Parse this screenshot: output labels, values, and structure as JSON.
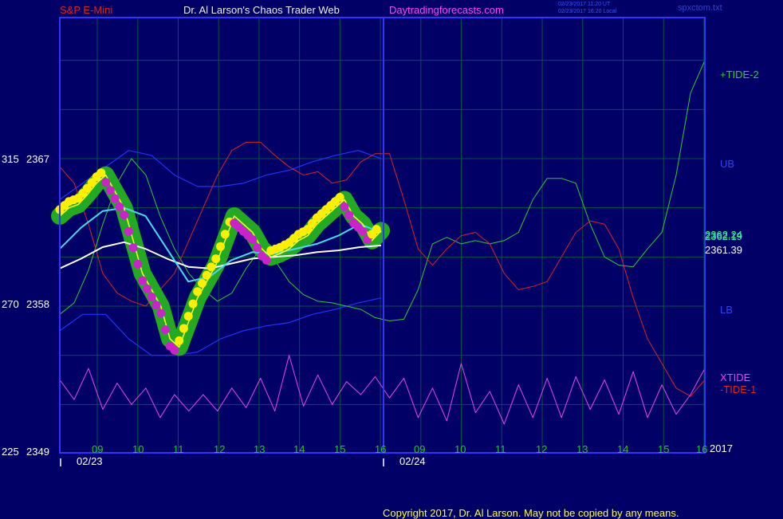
{
  "header": {
    "symbol": "S&P E-Mini",
    "author": "Dr. Al Larson's Chaos Trader Web",
    "site": "Daytradingforecasts.com",
    "timestamp1": "02/23/2017 11:20 UT",
    "timestamp2": "02/23/2017 16:20 Local",
    "file": "spxctom.txt"
  },
  "right_labels": {
    "tide2": "+TIDE-2",
    "ub": "UB",
    "price1": "2362.24",
    "price2": "2362.19",
    "price3": "2361.39",
    "lb": "LB",
    "xtide": "XTIDE",
    "tide1": "-TIDE-1",
    "year": "2017"
  },
  "footer": {
    "copyright": "Copyright 2017, Dr. Al Larson. May not be copied by any means."
  },
  "colors": {
    "background": "#000066",
    "frame": "#3333ff",
    "grid": "#005544",
    "tide2": "#33cc33",
    "tide1": "#dd2222",
    "xtide": "#ee44ee",
    "bands": "#2233ff",
    "cyan_avg": "#44ddee",
    "white_avg": "#ffffff",
    "price": "#ffff33",
    "hot_dots": "#ffee00",
    "cold_dots": "#cc22cc",
    "halo": "#22aa22",
    "header_symbol": "#dd2222",
    "header_site": "#ff44ff"
  },
  "chart_data": {
    "type": "line",
    "y_axis": [
      {
        "left": "315",
        "right": "2367"
      },
      {
        "left": "270",
        "right": "2358"
      },
      {
        "left": "225",
        "right": "2349"
      }
    ],
    "x_hours": [
      "09",
      "10",
      "11",
      "12",
      "13",
      "14",
      "15",
      "16",
      "09",
      "10",
      "11",
      "12",
      "13",
      "14",
      "15",
      "16"
    ],
    "dates": [
      "02/23",
      "02/24"
    ],
    "grid": true,
    "series": [
      {
        "name": "+TIDE-2",
        "values": [
          2357.5,
          2358.2,
          2360.2,
          2363.0,
          2365.5,
          2367.0,
          2366.0,
          2363.5,
          2361.5,
          2360.0,
          2359.0,
          2358.3,
          2358.8,
          2360.3,
          2361.5,
          2360.8,
          2359.5,
          2358.7,
          2358.3,
          2358.2,
          2358.0,
          2357.8,
          2357.3,
          2357.1,
          2357.2,
          2359.0,
          2361.8,
          2362.2,
          2361.8,
          2362.0,
          2361.8,
          2362.0,
          2362.5,
          2364.5,
          2365.8,
          2365.8,
          2365.5,
          2363.0,
          2361.0,
          2360.5,
          2360.4,
          2361.5,
          2362.5,
          2366.0,
          2371.0,
          2373.0
        ]
      },
      {
        "name": "-TIDE-1",
        "values": [
          2366.5,
          2365.5,
          2363.0,
          2360.0,
          2358.8,
          2358.3,
          2358.0,
          2359.0,
          2360.0,
          2362.0,
          2364.0,
          2366.0,
          2367.5,
          2368.0,
          2368.0,
          2367.2,
          2366.5,
          2366.0,
          2366.2,
          2365.5,
          2365.7,
          2366.8,
          2367.3,
          2367.3,
          2364.5,
          2361.5,
          2360.5,
          2361.5,
          2362.3,
          2362.5,
          2361.8,
          2360.0,
          2359.0,
          2359.2,
          2359.5,
          2361.0,
          2362.5,
          2363.2,
          2363.0,
          2361.5,
          2358.5,
          2356.0,
          2354.5,
          2353.0,
          2352.5,
          2353.5
        ]
      },
      {
        "name": "XTIDE",
        "values": [
          2353.5,
          2352.3,
          2354.2,
          2351.7,
          2353.3,
          2352.0,
          2353.0,
          2351.2,
          2352.6,
          2351.6,
          2352.6,
          2351.6,
          2353.0,
          2351.8,
          2353.6,
          2351.6,
          2355.0,
          2351.9,
          2353.8,
          2352.0,
          2353.4,
          2352.6,
          2353.7,
          2352.4,
          2353.6,
          2351.2,
          2353.0,
          2351.0,
          2354.5,
          2351.5,
          2352.8,
          2350.8,
          2353.2,
          2351.2,
          2353.6,
          2351.2,
          2353.7,
          2351.7,
          2353.5,
          2351.4,
          2354.0,
          2351.2,
          2353.2,
          2351.4,
          2352.6,
          2354.2
        ]
      },
      {
        "name": "UB",
        "values": [
          2364.5,
          2365.5,
          2366.5,
          2367.5,
          2367.2,
          2366.0,
          2365.3,
          2365.3,
          2365.5,
          2366.0,
          2366.3,
          2366.8,
          2367.2,
          2367.5,
          2367.0
        ]
      },
      {
        "name": "LB",
        "values": [
          2356.5,
          2357.5,
          2357.5,
          2356.0,
          2355.0,
          2355.0,
          2355.2,
          2356.0,
          2356.5,
          2356.8,
          2357.0,
          2357.5,
          2357.8,
          2358.2,
          2358.5
        ]
      },
      {
        "name": "cyan_avg",
        "values": [
          2361.5,
          2362.8,
          2363.8,
          2364.0,
          2363.5,
          2361.5,
          2359.5,
          2359.8,
          2360.8,
          2361.3,
          2361.2,
          2361.5,
          2361.8,
          2362.3,
          2363.0,
          2362.5
        ]
      },
      {
        "name": "white_avg",
        "values": [
          2360.3,
          2360.9,
          2361.6,
          2361.9,
          2361.5,
          2360.9,
          2360.4,
          2360.3,
          2360.6,
          2360.9,
          2361.0,
          2361.1,
          2361.3,
          2361.4,
          2361.6,
          2361.7
        ]
      },
      {
        "name": "price",
        "values": [
          2363.5,
          2364.0,
          2364.2,
          2364.8,
          2365.5,
          2366.0,
          2365.0,
          2364.0,
          2362.0,
          2360.0,
          2359.0,
          2358.0,
          2356.0,
          2355.5,
          2357.0,
          2358.5,
          2359.5,
          2360.5,
          2362.0,
          2363.5,
          2363.0,
          2362.5,
          2361.5,
          2361.0,
          2361.2,
          2361.5,
          2362.0,
          2362.3,
          2363.0,
          2363.5,
          2364.0,
          2364.5,
          2363.5,
          2363.0,
          2362.0,
          2362.6
        ]
      }
    ]
  }
}
